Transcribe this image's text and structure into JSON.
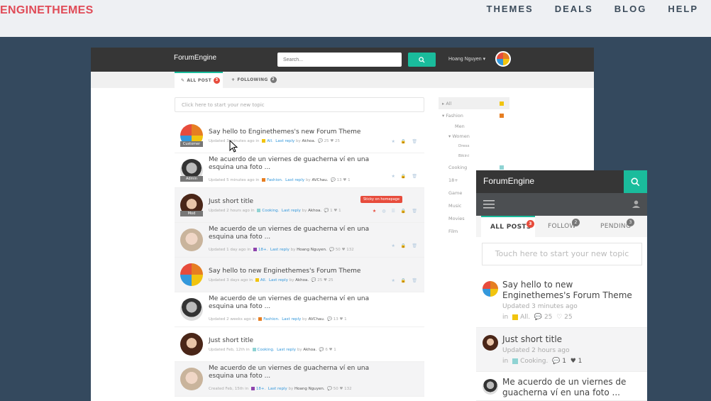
{
  "site": {
    "brand": "ENGINETHEMES",
    "nav": [
      "THEMES",
      "DEALS",
      "BLOG",
      "HELP"
    ]
  },
  "desktop": {
    "logo": "ForumEngine",
    "search_placeholder": "Search...",
    "user": "Hoang Nguyen",
    "tabs": [
      {
        "label": "ALL POST",
        "count": "3"
      },
      {
        "label": "FOLLOWING",
        "count": "2"
      }
    ],
    "new_topic_placeholder": "Click here to start your new topic",
    "sticky_tooltip": "Sticky on homepage",
    "posts": [
      {
        "title": "Say hello to Enginethemes's new Forum Theme",
        "meta1": "Updated ",
        "meta_time": "3 minutes ago",
        "category": "All.",
        "cat_color": "#f1c40f",
        "author": "Akhoa.",
        "comments": "25",
        "likes": "25",
        "role": "Customer"
      },
      {
        "title": "Me acuerdo de un viernes de guacherna ví en una esquina una foto ...",
        "meta_time": "Updated 5 minutes ago in",
        "category": "Fashion.",
        "cat_color": "#e67e22",
        "author": "AVChau.",
        "comments": "13",
        "likes": "1",
        "role": "Admin"
      },
      {
        "title": "Just short title",
        "meta_time": "Updated 2 hours ago in",
        "category": "Cooking.",
        "cat_color": "#8fd3d3",
        "author": "Akhoa.",
        "comments": "1",
        "likes": "1",
        "role": "Mod"
      },
      {
        "title": "Me acuerdo de un viernes de guacherna ví en una esquina una foto ...",
        "meta_time": "Updated 1 day ago in",
        "category": "18+.",
        "cat_color": "#8e44ad",
        "author": "Hoang Nguyen.",
        "comments": "50",
        "likes": "132",
        "role": ""
      },
      {
        "title": "Say hello to new Enginethemes's Forum Theme",
        "meta_time": "Updated 3 days ago in",
        "category": "All.",
        "cat_color": "#f1c40f",
        "author": "Akhoa.",
        "comments": "25",
        "likes": "25",
        "role": ""
      },
      {
        "title": "Me acuerdo de un viernes de guacherna ví en una esquina una foto ...",
        "meta_time": "Updated 2 weeks ago in",
        "category": "Fashion.",
        "cat_color": "#e67e22",
        "author": "AVChau.",
        "comments": "13",
        "likes": "1",
        "role": ""
      },
      {
        "title": "Just short title",
        "meta_time": "Updated Feb, 12th in",
        "category": "Cooking.",
        "cat_color": "#8fd3d3",
        "author": "Akhoa.",
        "comments": "6",
        "likes": "1",
        "role": ""
      },
      {
        "title": "Me acuerdo de un viernes de guacherna ví en una esquina una foto ...",
        "meta_time": "Created Feb, 15th in",
        "category": "18+.",
        "cat_color": "#8e44ad",
        "author": "Hoang Nguyen.",
        "comments": "50",
        "likes": "132",
        "role": ""
      }
    ],
    "last_reply": "Last reply",
    "by": "by",
    "categories": [
      {
        "label": "All",
        "indent": 0,
        "arrow": "▸",
        "color": "#f1c40f"
      },
      {
        "label": "Fashion",
        "indent": 0,
        "arrow": "▾",
        "color": "#e67e22"
      },
      {
        "label": "Men",
        "indent": 2,
        "arrow": "",
        "color": ""
      },
      {
        "label": "Women",
        "indent": 1,
        "arrow": "▾",
        "color": ""
      },
      {
        "label": "Dress",
        "indent": 3,
        "arrow": "",
        "color": ""
      },
      {
        "label": "Bikini",
        "indent": 3,
        "arrow": "",
        "color": ""
      },
      {
        "label": "Cooking",
        "indent": 0,
        "arrow": "",
        "color": "#8fd3d3"
      },
      {
        "label": "18+",
        "indent": 0,
        "arrow": "",
        "color": ""
      },
      {
        "label": "Game",
        "indent": 0,
        "arrow": "",
        "color": ""
      },
      {
        "label": "Music",
        "indent": 0,
        "arrow": "",
        "color": ""
      },
      {
        "label": "Movies",
        "indent": 0,
        "arrow": "",
        "color": ""
      },
      {
        "label": "Film",
        "indent": 0,
        "arrow": "",
        "color": ""
      }
    ]
  },
  "mobile": {
    "logo": "ForumEngine",
    "tabs": [
      {
        "label": "ALL POSTS",
        "count": "3"
      },
      {
        "label": "FOLLOW",
        "count": "2"
      },
      {
        "label": "PENDING",
        "count": "3"
      }
    ],
    "new_topic_placeholder": "Touch here to start your new topic",
    "posts": [
      {
        "title": "Say hello to new Enginethemes's Forum Theme",
        "time": "Updated 3 minutes ago",
        "in": "in",
        "category": "All.",
        "cat_color": "#f1c40f",
        "comments": "25",
        "likes": "25"
      },
      {
        "title": "Just short title",
        "time": "Updated 2 hours ago",
        "in": "in",
        "category": "Cooking.",
        "cat_color": "#8fd3d3",
        "comments": "1",
        "likes": "1"
      },
      {
        "title": "Me acuerdo de un viernes de guacherna ví en una foto ...",
        "time": "",
        "in": "",
        "category": "",
        "cat_color": "",
        "comments": "",
        "likes": ""
      }
    ]
  }
}
